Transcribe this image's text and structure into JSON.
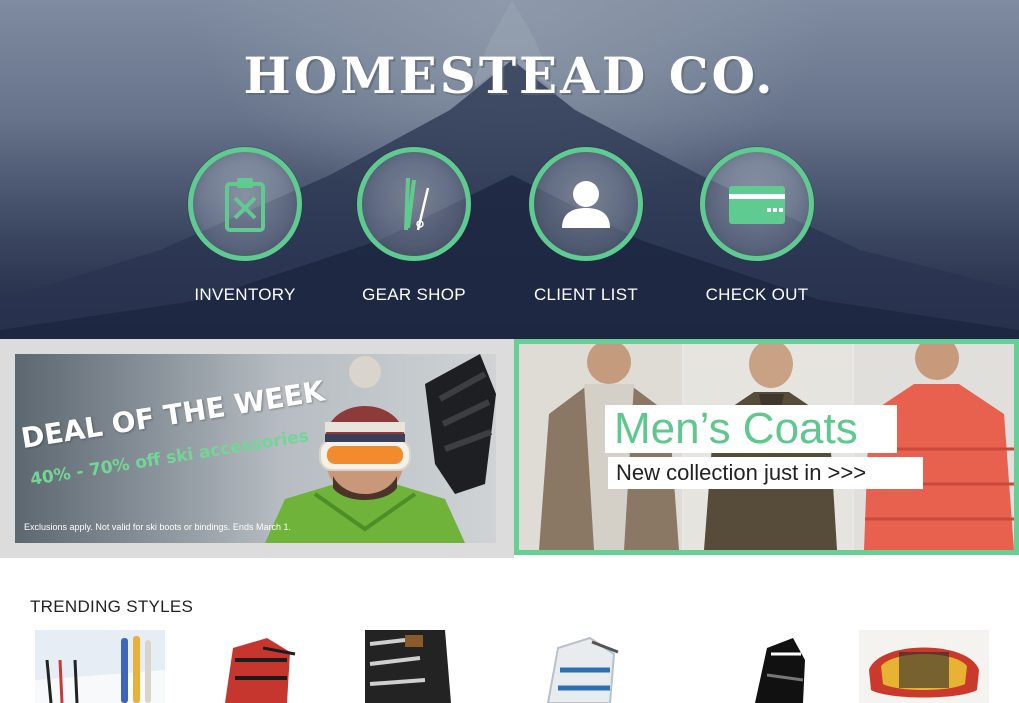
{
  "brand": {
    "name": "HOMESTEAD CO."
  },
  "nav": [
    {
      "label": "INVENTORY",
      "icon": "clipboard-icon"
    },
    {
      "label": "GEAR SHOP",
      "icon": "skis-icon"
    },
    {
      "label": "CLIENT LIST",
      "icon": "user-icon"
    },
    {
      "label": "CHECK OUT",
      "icon": "credit-card-icon"
    }
  ],
  "promos": {
    "deal": {
      "title": "DEAL OF THE WEEK",
      "subtitle": "40% - 70% off ski accessories",
      "fine_print": "Exclusions apply. Not valid for ski boots or bindings. Ends March 1."
    },
    "coats": {
      "title": "Men’s Coats",
      "subtitle": "New collection just in >>>"
    }
  },
  "trending": {
    "heading": "TRENDING STYLES",
    "items": [
      {
        "icon": "skis-and-poles-product"
      },
      {
        "icon": "red-ski-boot-product"
      },
      {
        "icon": "black-buckle-boot-product"
      },
      {
        "icon": "white-blue-ski-boot-product"
      },
      {
        "icon": "xc-ski-boot-product"
      },
      {
        "icon": "ski-goggles-product"
      }
    ]
  },
  "colors": {
    "accent": "#5fcb91",
    "hero_dark": "#1d2740",
    "text": "#222222"
  }
}
